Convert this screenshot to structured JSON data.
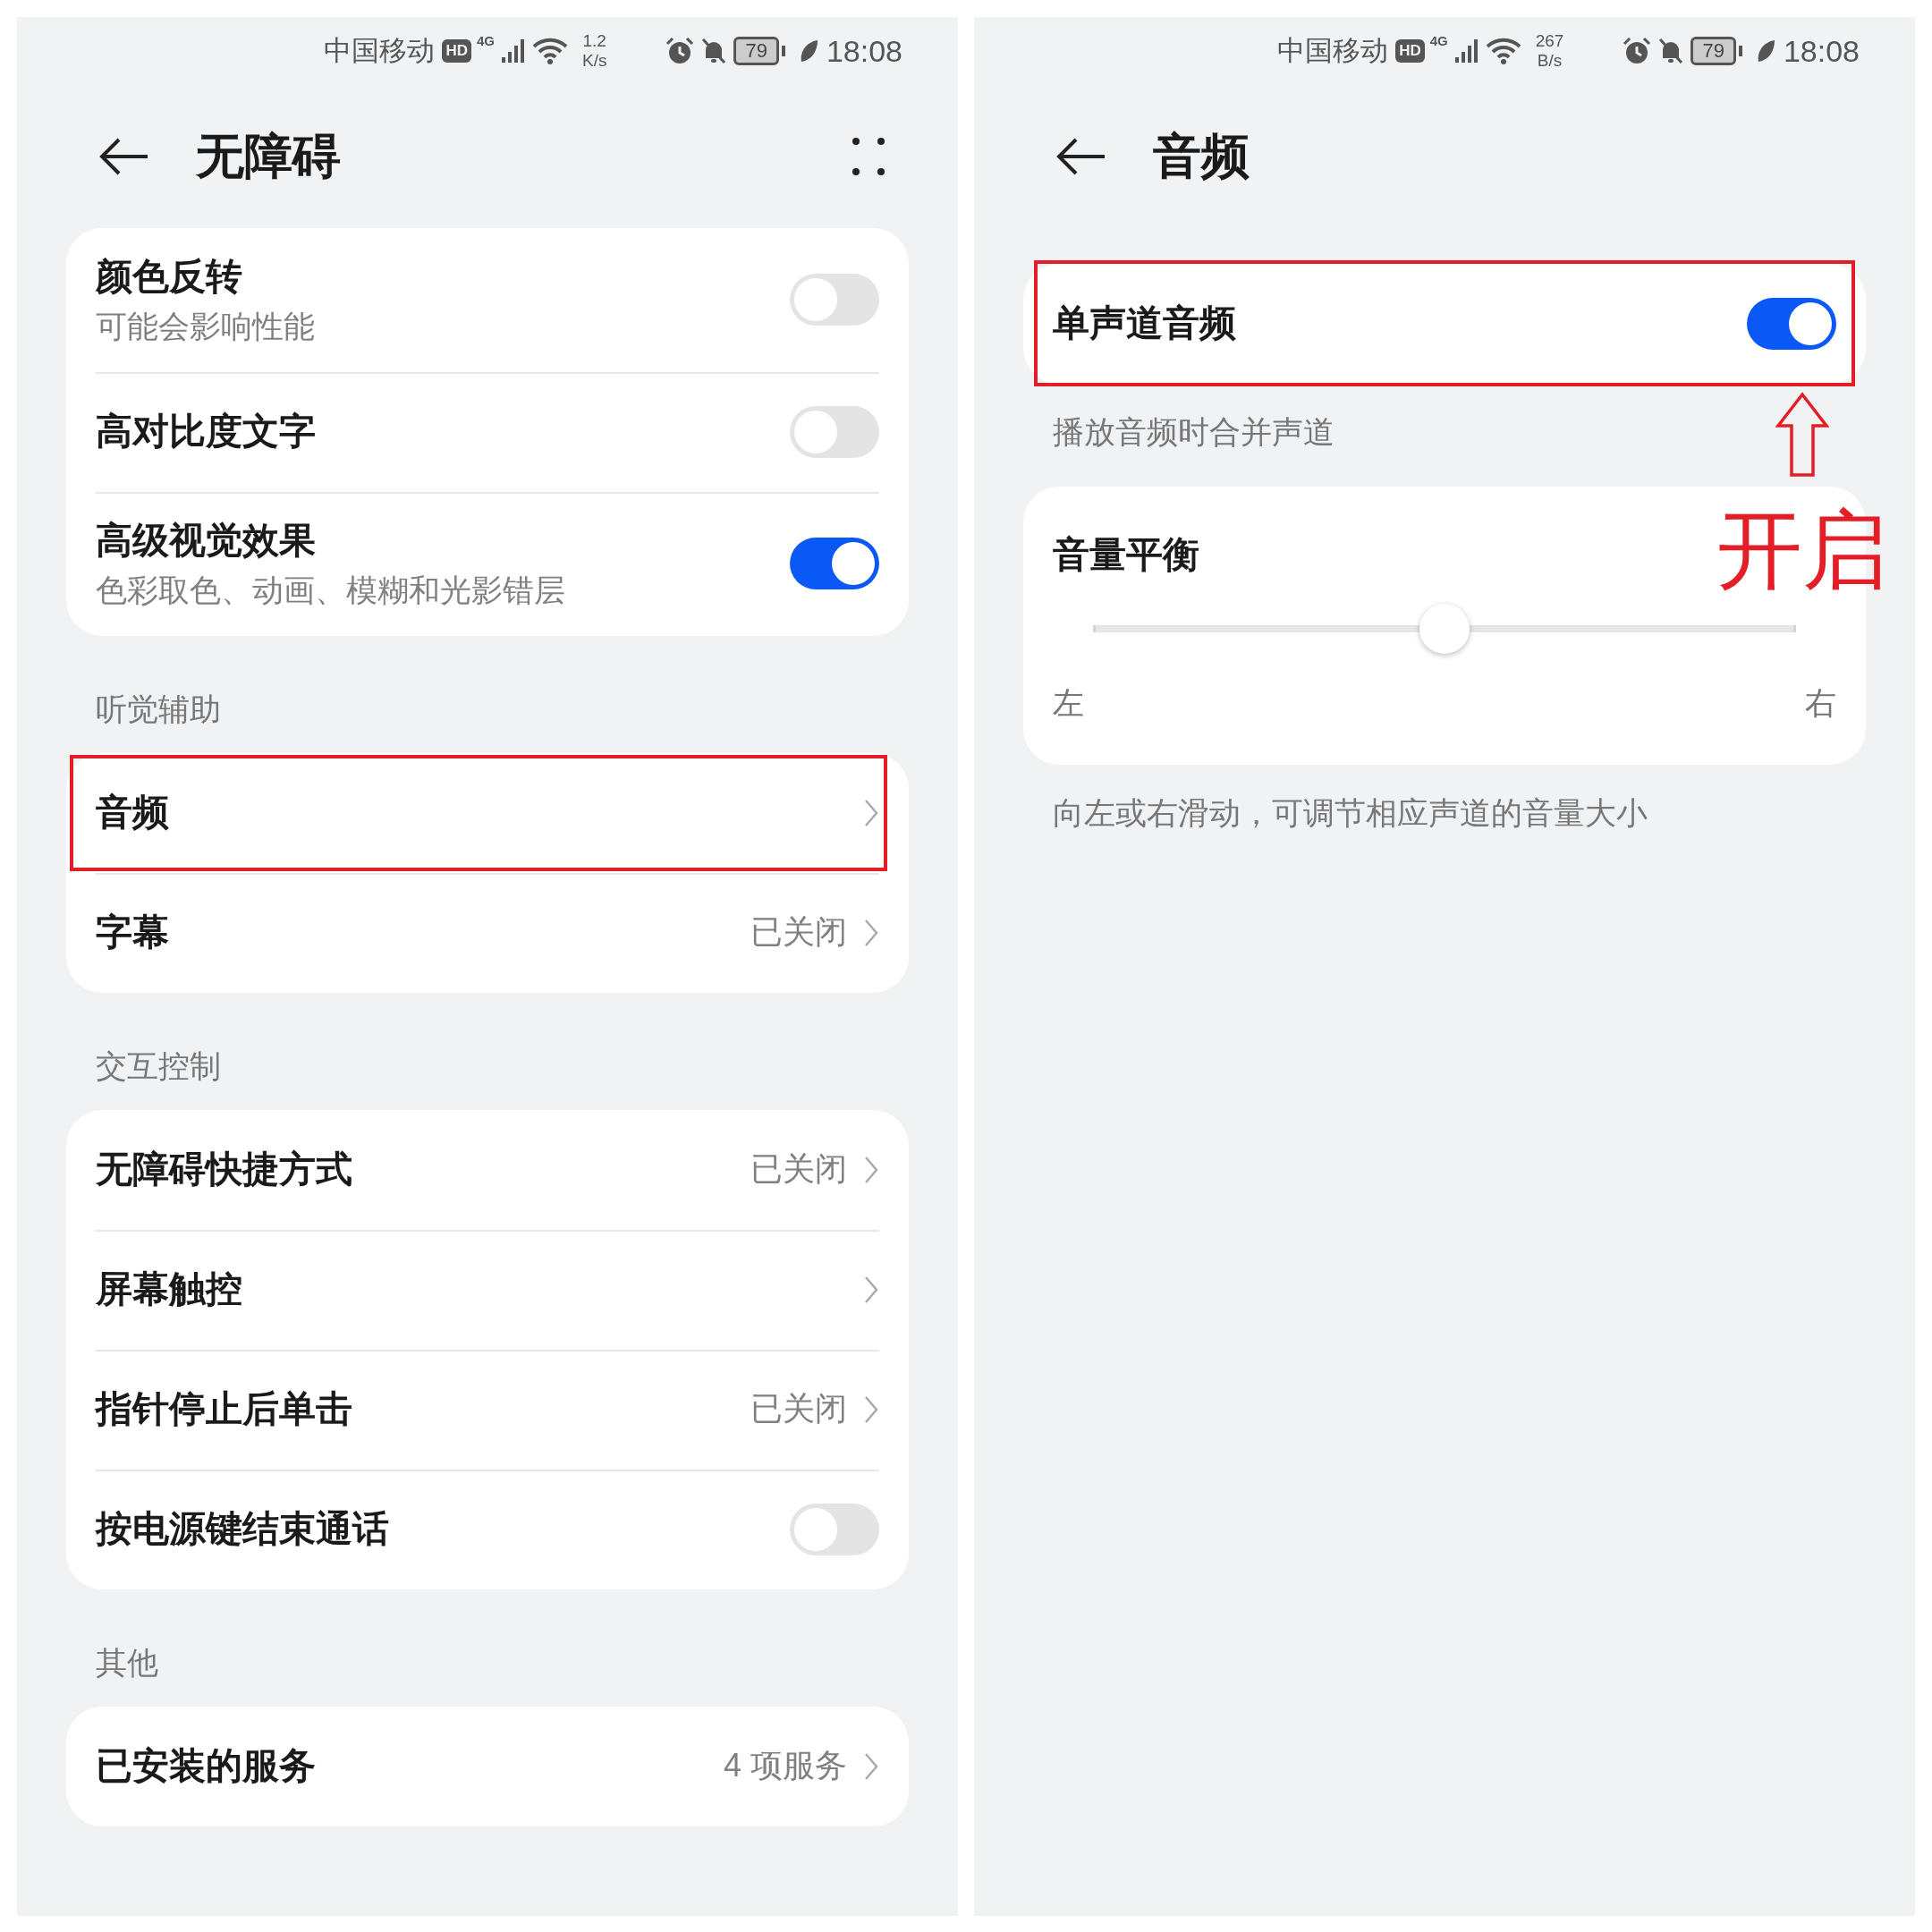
{
  "panels": [
    {
      "kind": "list",
      "status_bar": {
        "carrier": "中国移动",
        "hd": "HD",
        "network": "4G",
        "speed_value": "1.2",
        "speed_unit": "K/s",
        "battery": "79",
        "time": "18:08"
      },
      "header": {
        "title": "无障碍",
        "menu": true
      },
      "blocks": [
        {
          "kind": "card",
          "items": [
            {
              "kind": "toggle",
              "title": "颜色反转",
              "subtitle": "可能会影响性能",
              "on": false,
              "highlighted": false
            },
            {
              "kind": "toggle",
              "title": "高对比度文字",
              "on": false,
              "highlighted": false
            },
            {
              "kind": "toggle",
              "title": "高级视觉效果",
              "subtitle": "色彩取色、动画、模糊和光影错层",
              "on": true,
              "highlighted": false
            }
          ]
        },
        {
          "kind": "heading",
          "text": "听觉辅助"
        },
        {
          "kind": "card",
          "items": [
            {
              "kind": "link",
              "title": "音频",
              "highlighted": true
            },
            {
              "kind": "link",
              "title": "字幕",
              "value": "已关闭",
              "highlighted": false
            }
          ]
        },
        {
          "kind": "heading",
          "text": "交互控制"
        },
        {
          "kind": "card",
          "items": [
            {
              "kind": "link",
              "title": "无障碍快捷方式",
              "value": "已关闭",
              "highlighted": false
            },
            {
              "kind": "link",
              "title": "屏幕触控",
              "highlighted": false
            },
            {
              "kind": "link",
              "title": "指针停止后单击",
              "value": "已关闭",
              "highlighted": false
            },
            {
              "kind": "toggle",
              "title": "按电源键结束通话",
              "on": false,
              "highlighted": false
            }
          ]
        },
        {
          "kind": "heading",
          "text": "其他"
        },
        {
          "kind": "card",
          "items": [
            {
              "kind": "link",
              "title": "已安装的服务",
              "value": "4 项服务",
              "highlighted": false
            }
          ]
        }
      ]
    },
    {
      "kind": "detail",
      "status_bar": {
        "carrier": "中国移动",
        "hd": "HD",
        "network": "4G",
        "speed_value": "267",
        "speed_unit": "B/s",
        "battery": "79",
        "time": "18:08"
      },
      "header": {
        "title": "音频",
        "menu": false
      },
      "blocks": [
        {
          "kind": "card",
          "items": [
            {
              "kind": "toggle",
              "title": "单声道音频",
              "on": true,
              "highlighted": true
            }
          ]
        },
        {
          "kind": "note",
          "text": "播放音频时合并声道"
        },
        {
          "kind": "card",
          "items": [
            {
              "kind": "slider",
              "title": "音量平衡",
              "level": 0.5,
              "left_label": "左",
              "right_label": "右",
              "highlighted": false
            }
          ]
        },
        {
          "kind": "note",
          "text": "向左或右滑动，可调节相应声道的音量大小"
        }
      ],
      "annotation": {
        "text": "开启"
      }
    }
  ]
}
